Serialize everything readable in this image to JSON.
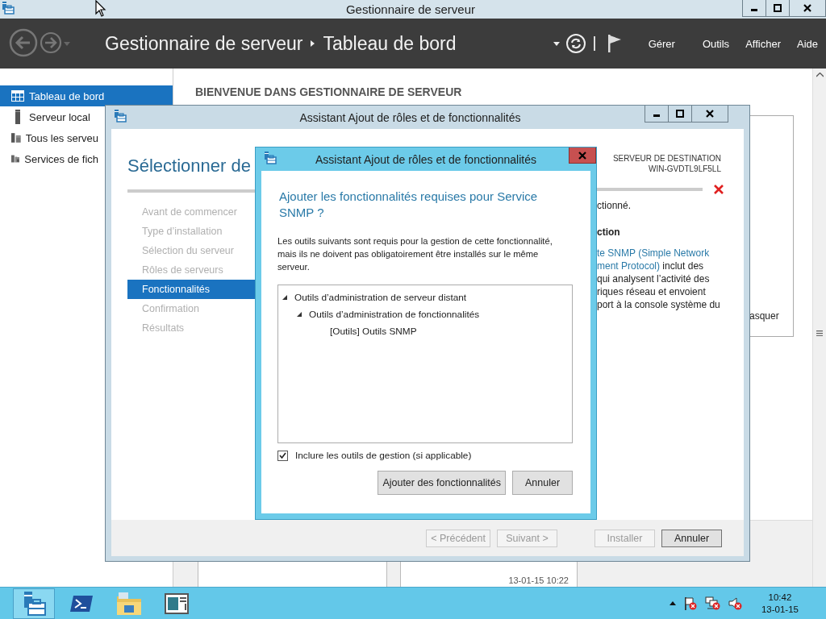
{
  "main_window": {
    "title": "Gestionnaire de serveur"
  },
  "header": {
    "breadcrumb": [
      "Gestionnaire de serveur",
      "Tableau de bord"
    ],
    "menu": [
      "Gérer",
      "Outils",
      "Afficher",
      "Aide"
    ]
  },
  "sidebar": {
    "items": [
      {
        "label": "Tableau de bord",
        "selected": true
      },
      {
        "label": "Serveur local",
        "selected": false
      },
      {
        "label": "Tous les serveu",
        "selected": false
      },
      {
        "label": "Services de fich",
        "selected": false
      }
    ]
  },
  "content": {
    "heading": "BIENVENUE DANS GESTIONNAIRE DE SERVEUR",
    "tile_text": "asquer",
    "timestamp": "13-01-15 10:22"
  },
  "wizard": {
    "title": "Assistant Ajout de rôles et de fonctionnalités",
    "heading": "Sélectionner de",
    "destination_label": "SERVEUR DE DESTINATION",
    "destination_server": "WIN-GVDTL9LF5LL",
    "steps": [
      {
        "label": "Avant de commencer",
        "selected": false
      },
      {
        "label": "Type d’installation",
        "selected": false
      },
      {
        "label": "Sélection du serveur",
        "selected": false
      },
      {
        "label": "Rôles de serveurs",
        "selected": false
      },
      {
        "label": "Fonctionnalités",
        "selected": true
      },
      {
        "label": "Confirmation",
        "selected": false
      },
      {
        "label": "Résultats",
        "selected": false
      }
    ],
    "status_text": "ctionné.",
    "description_heading": "ction",
    "description_lines": [
      {
        "link": "te SNMP (Simple Network"
      },
      {
        "link": "ment Protocol)",
        "text": " inclut des"
      },
      {
        "text": "qui analysent l’activité des"
      },
      {
        "text": "riques réseau et envoient"
      },
      {
        "text": "port à la console système du"
      }
    ],
    "buttons": [
      {
        "label": "< Précédent",
        "disabled": true,
        "default": false
      },
      {
        "label": "Suivant >",
        "disabled": true,
        "default": false
      },
      {
        "label": "Installer",
        "disabled": true,
        "default": false
      },
      {
        "label": "Annuler",
        "disabled": false,
        "default": true
      }
    ]
  },
  "dialog": {
    "title": "Assistant Ajout de rôles et de fonctionnalités",
    "heading": "Ajouter les fonctionnalités requises pour Service SNMP ?",
    "message": "Les outils suivants sont requis pour la gestion de cette fonctionnalité, mais ils ne doivent pas obligatoirement être installés sur le même serveur.",
    "tree": [
      {
        "label": "Outils d’administration de serveur distant",
        "expanded": true,
        "children": [
          {
            "label": "Outils d’administration de fonctionnalités",
            "expanded": true,
            "children": [
              {
                "label": "[Outils] Outils SNMP"
              }
            ]
          }
        ]
      }
    ],
    "include_tools": {
      "label": "Inclure les outils de gestion (si applicable)",
      "checked": true
    },
    "buttons": [
      "Ajouter des fonctionnalités",
      "Annuler"
    ]
  },
  "taskbar": {
    "apps": [
      {
        "selected": true
      },
      {
        "selected": false
      },
      {
        "selected": false
      },
      {
        "selected": false
      }
    ],
    "clock_time": "10:42",
    "clock_date": "13-01-15"
  }
}
